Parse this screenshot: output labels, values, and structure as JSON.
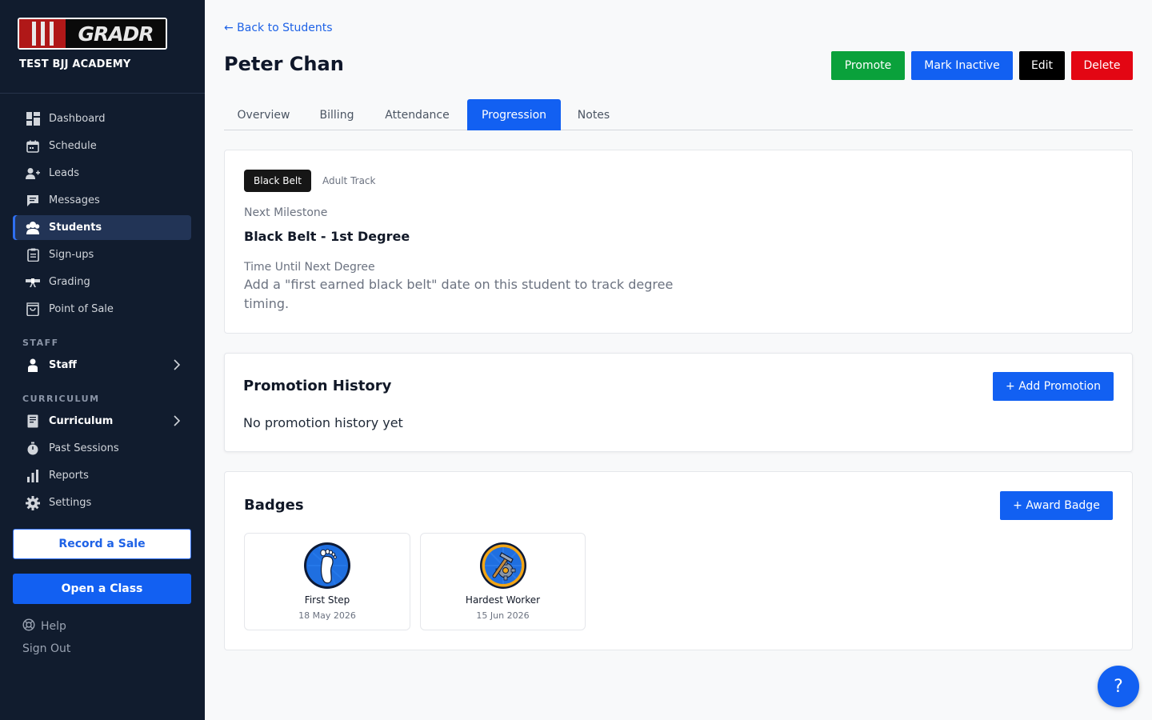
{
  "brand": {
    "logo_text": "GRADR",
    "academy": "TEST BJJ ACADEMY"
  },
  "sidebar": {
    "items": [
      {
        "label": "Dashboard",
        "icon": "dashboard-icon"
      },
      {
        "label": "Schedule",
        "icon": "calendar-icon"
      },
      {
        "label": "Leads",
        "icon": "add-user-icon"
      },
      {
        "label": "Messages",
        "icon": "message-icon"
      },
      {
        "label": "Students",
        "icon": "students-icon",
        "active": true
      },
      {
        "label": "Sign-ups",
        "icon": "clipboard-icon"
      },
      {
        "label": "Grading",
        "icon": "belt-icon"
      },
      {
        "label": "Point of Sale",
        "icon": "shopping-bag-icon"
      }
    ],
    "staff_section": "STAFF",
    "staff_item": "Staff",
    "curriculum_section": "CURRICULUM",
    "curriculum_items": [
      {
        "label": "Curriculum",
        "icon": "book-icon"
      },
      {
        "label": "Past Sessions",
        "icon": "stopwatch-icon"
      },
      {
        "label": "Reports",
        "icon": "bar-chart-icon"
      },
      {
        "label": "Settings",
        "icon": "gear-icon"
      }
    ],
    "record_sale": "Record a Sale",
    "open_class": "Open a Class",
    "help": "Help",
    "sign_out": "Sign Out"
  },
  "header": {
    "back_link": "← Back to Students",
    "student_name": "Peter Chan",
    "actions": {
      "promote": "Promote",
      "mark_inactive": "Mark Inactive",
      "edit": "Edit",
      "delete": "Delete"
    }
  },
  "tabs": [
    "Overview",
    "Billing",
    "Attendance",
    "Progression",
    "Notes"
  ],
  "active_tab": "Progression",
  "progression": {
    "belt": "Black Belt",
    "track": "Adult Track",
    "next_milestone_label": "Next Milestone",
    "next_milestone": "Black Belt - 1st Degree",
    "time_label": "Time Until Next Degree",
    "time_text": "Add a \"first earned black belt\" date on this student to track degree timing."
  },
  "promotion_history": {
    "title": "Promotion History",
    "add_button": "+ Add Promotion",
    "empty_text": "No promotion history yet"
  },
  "badges": {
    "title": "Badges",
    "award_button": "+ Award Badge",
    "items": [
      {
        "name": "First Step",
        "date": "18 May 2026",
        "icon": "footprint-icon"
      },
      {
        "name": "Hardest Worker",
        "date": "15 Jun 2026",
        "icon": "hammer-gear-icon"
      }
    ]
  },
  "help_fab": "?",
  "colors": {
    "sidebar_bg": "#111c2e",
    "primary": "#1260f2",
    "promote": "#0aa13b",
    "delete": "#e30613"
  }
}
